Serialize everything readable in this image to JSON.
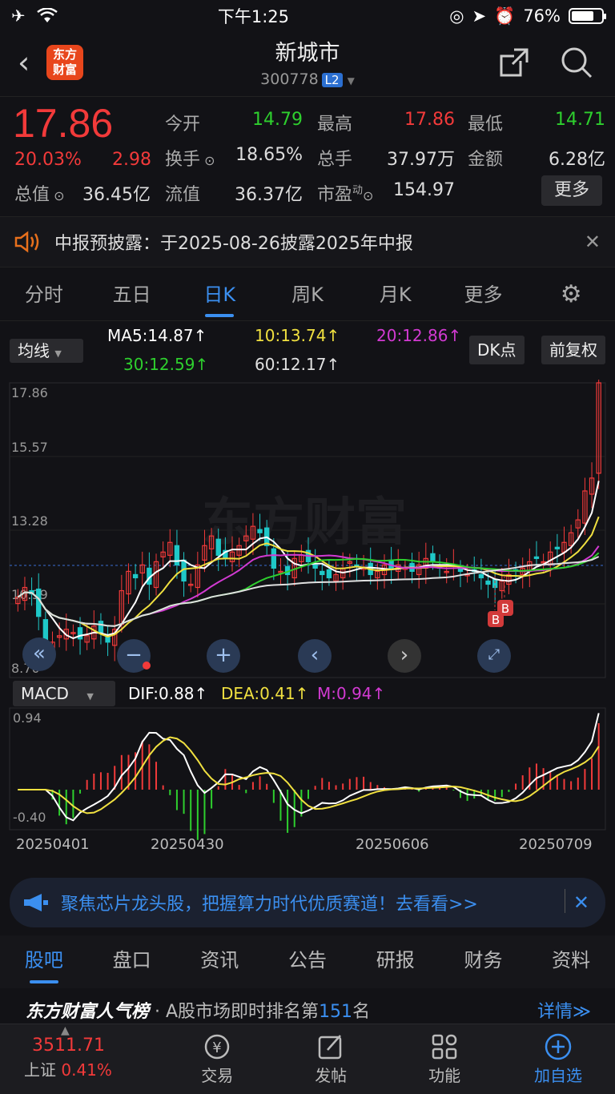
{
  "status": {
    "time": "下午1:25",
    "battery": "76%",
    "battery_level": 0.76
  },
  "nav": {
    "back": "‹",
    "logo_line1": "东方",
    "logo_line2": "财富",
    "title": "新城市",
    "code": "300778",
    "l2": "L2"
  },
  "quote": {
    "price": "17.86",
    "pct": "20.03%",
    "change": "2.98",
    "labels": {
      "open": "今开",
      "high": "最高",
      "low": "最低",
      "turnover": "换手",
      "volume": "总手",
      "amount": "金额",
      "mktcap": "总值",
      "float": "流值",
      "pe": "市盈",
      "pe_sup": "动"
    },
    "values": {
      "open": "14.79",
      "high": "17.86",
      "low": "14.71",
      "turnover": "18.65%",
      "volume": "37.97万",
      "amount": "6.28亿",
      "mktcap": "36.45亿",
      "float": "36.37亿",
      "pe": "154.97"
    },
    "more": "更多"
  },
  "notice": {
    "text": "中报预披露：于2025-08-26披露2025年中报",
    "close": "✕"
  },
  "tabs": [
    "分时",
    "五日",
    "日K",
    "周K",
    "月K",
    "更多",
    "⚙"
  ],
  "ma": {
    "selector": "均线",
    "ma5": "MA5:14.87↑",
    "ma10": "10:13.74↑",
    "ma20": "20:12.86↑",
    "ma30": "30:12.59↑",
    "ma60": "60:12.17↑",
    "dk": "DK点",
    "fq": "前复权",
    "colors": {
      "ma5": "#ffffff",
      "ma10": "#f0e040",
      "ma20": "#d23ad2",
      "ma30": "#2ecf2e",
      "ma60": "#e0e0e0"
    }
  },
  "macd": {
    "selector": "MACD",
    "dif": "DIF:0.88↑",
    "dea": "DEA:0.41↑",
    "m": "M:0.94↑"
  },
  "chart_data": {
    "type": "candlestick",
    "price_axis_labels": [
      "17.86",
      "15.57",
      "13.28",
      "10.99",
      "8.70"
    ],
    "macd_axis_labels": [
      "0.94",
      "-0.40"
    ],
    "date_labels": [
      "20250401",
      "20250430",
      "20250606",
      "20250709"
    ],
    "ylim": [
      8.7,
      17.86
    ],
    "close": [
      11.2,
      11.5,
      11.3,
      10.6,
      9.5,
      9.8,
      10.0,
      10.2,
      10.1,
      9.9,
      10.0,
      10.3,
      10.1,
      9.8,
      10.2,
      11.4,
      12.0,
      11.8,
      12.2,
      11.6,
      12.3,
      12.6,
      12.9,
      12.2,
      11.7,
      11.6,
      12.2,
      12.8,
      13.1,
      12.5,
      12.4,
      12.6,
      12.8,
      13.1,
      13.4,
      13.2,
      12.8,
      12.1,
      12.0,
      11.9,
      12.4,
      12.5,
      12.3,
      12.1,
      11.9,
      11.8,
      11.9,
      12.1,
      12.3,
      12.2,
      12.1,
      11.9,
      12.0,
      12.2,
      12.1,
      12.2,
      12.1,
      12.0,
      12.2,
      12.4,
      12.3,
      12.1,
      12.0,
      12.2,
      12.0,
      11.9,
      12.0,
      11.8,
      11.6,
      11.5,
      11.7,
      11.9,
      12.0,
      12.1,
      12.3,
      12.4,
      12.3,
      12.6,
      12.7,
      12.9,
      13.2,
      13.6,
      14.5,
      14.9,
      17.86
    ],
    "b_markers": [
      "B",
      "B"
    ]
  },
  "ad": {
    "text": "聚焦芯片龙头股，把握算力时代优质赛道！去看看>>",
    "close": "✕"
  },
  "bottom_tabs": [
    "股吧",
    "盘口",
    "资讯",
    "公告",
    "研报",
    "财务",
    "资料"
  ],
  "rank": {
    "brand": "东方财富人气榜",
    "text": "· A股市场即时排名第",
    "num": "151",
    "suffix": "名",
    "detail": "详情≫"
  },
  "tabbar": {
    "index_value": "3511.71",
    "index_name": "上证",
    "index_pct": "0.41%",
    "items": [
      "交易",
      "发帖",
      "功能",
      "加自选"
    ]
  }
}
